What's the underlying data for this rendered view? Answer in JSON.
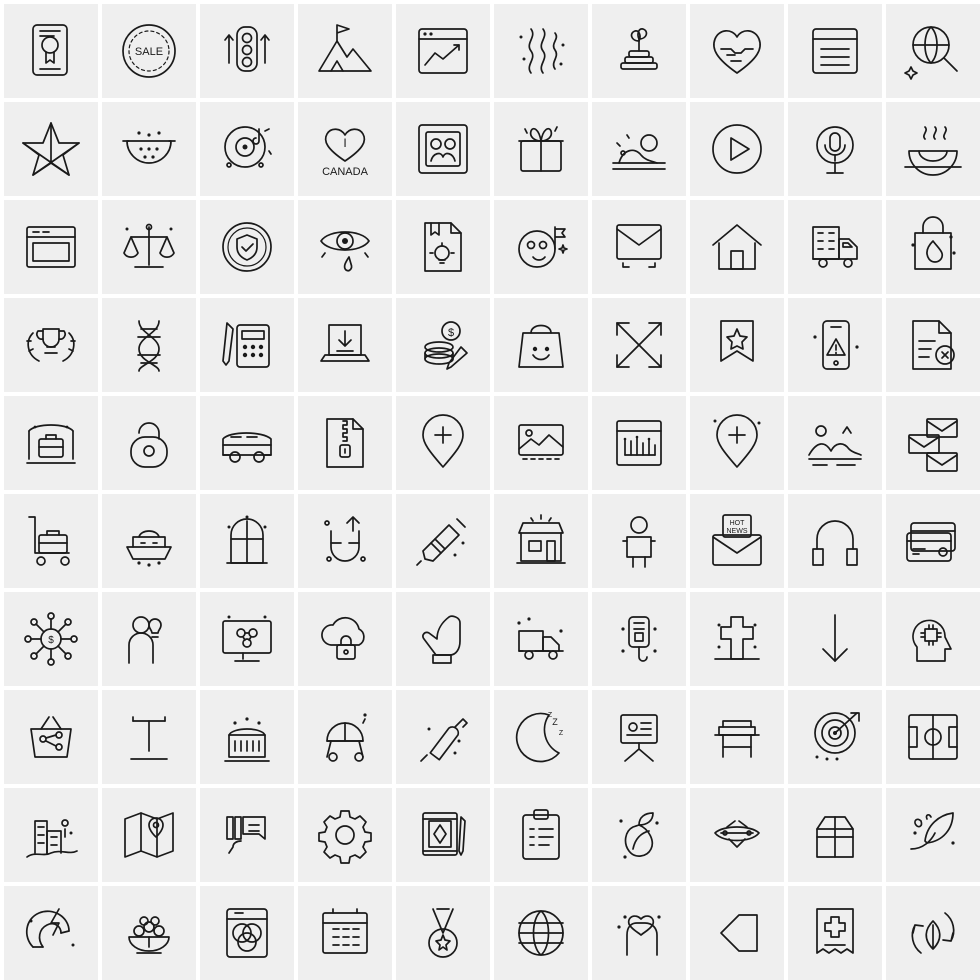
{
  "page": {
    "title": "Line Icon Set Sheet",
    "grid": {
      "columns": 10,
      "rows": 10,
      "cell_size": 94,
      "gap": 4
    },
    "colors": {
      "background": "#ffffff",
      "cell_background": "#efefef",
      "stroke": "#1a1a1a"
    }
  },
  "icons": [
    {
      "row": 1,
      "col": 1,
      "name": "certificate-document-icon",
      "label": ""
    },
    {
      "row": 1,
      "col": 2,
      "name": "sale-badge-icon",
      "label": "SALE"
    },
    {
      "row": 1,
      "col": 3,
      "name": "traffic-light-icon",
      "label": ""
    },
    {
      "row": 1,
      "col": 4,
      "name": "mountain-flag-icon",
      "label": ""
    },
    {
      "row": 1,
      "col": 5,
      "name": "browser-chart-icon",
      "label": ""
    },
    {
      "row": 1,
      "col": 6,
      "name": "heat-waves-icon",
      "label": ""
    },
    {
      "row": 1,
      "col": 7,
      "name": "plant-coins-growth-icon",
      "label": ""
    },
    {
      "row": 1,
      "col": 8,
      "name": "heart-handshake-icon",
      "label": ""
    },
    {
      "row": 1,
      "col": 9,
      "name": "document-lines-icon",
      "label": ""
    },
    {
      "row": 1,
      "col": 10,
      "name": "global-search-icon",
      "label": ""
    },
    {
      "row": 2,
      "col": 1,
      "name": "star-ribbon-icon",
      "label": ""
    },
    {
      "row": 2,
      "col": 2,
      "name": "colander-strainer-icon",
      "label": ""
    },
    {
      "row": 2,
      "col": 3,
      "name": "vinyl-record-music-icon",
      "label": ""
    },
    {
      "row": 2,
      "col": 4,
      "name": "i-love-canada-icon",
      "label": "CANADA"
    },
    {
      "row": 2,
      "col": 5,
      "name": "framed-portrait-icon",
      "label": ""
    },
    {
      "row": 2,
      "col": 6,
      "name": "gift-box-icon",
      "label": ""
    },
    {
      "row": 2,
      "col": 7,
      "name": "sunset-hills-icon",
      "label": ""
    },
    {
      "row": 2,
      "col": 8,
      "name": "play-button-icon",
      "label": ""
    },
    {
      "row": 2,
      "col": 9,
      "name": "microphone-icon",
      "label": ""
    },
    {
      "row": 2,
      "col": 10,
      "name": "soup-bowl-icon",
      "label": ""
    },
    {
      "row": 3,
      "col": 1,
      "name": "window-frame-icon",
      "label": ""
    },
    {
      "row": 3,
      "col": 2,
      "name": "justice-scales-icon",
      "label": ""
    },
    {
      "row": 3,
      "col": 3,
      "name": "shield-protection-icon",
      "label": ""
    },
    {
      "row": 3,
      "col": 4,
      "name": "eye-tear-icon",
      "label": ""
    },
    {
      "row": 3,
      "col": 5,
      "name": "idea-document-icon",
      "label": ""
    },
    {
      "row": 3,
      "col": 6,
      "name": "moon-flag-icon",
      "label": ""
    },
    {
      "row": 3,
      "col": 7,
      "name": "email-envelope-icon",
      "label": ""
    },
    {
      "row": 3,
      "col": 8,
      "name": "home-house-icon",
      "label": ""
    },
    {
      "row": 3,
      "col": 9,
      "name": "delivery-truck-building-icon",
      "label": ""
    },
    {
      "row": 3,
      "col": 10,
      "name": "fire-bag-icon",
      "label": ""
    },
    {
      "row": 4,
      "col": 1,
      "name": "trophy-laurel-icon",
      "label": ""
    },
    {
      "row": 4,
      "col": 2,
      "name": "dna-helix-icon",
      "label": ""
    },
    {
      "row": 4,
      "col": 3,
      "name": "calculator-pen-icon",
      "label": ""
    },
    {
      "row": 4,
      "col": 4,
      "name": "download-laptop-icon",
      "label": ""
    },
    {
      "row": 4,
      "col": 5,
      "name": "money-coins-pen-icon",
      "label": ""
    },
    {
      "row": 4,
      "col": 6,
      "name": "shopping-bag-smile-icon",
      "label": ""
    },
    {
      "row": 4,
      "col": 7,
      "name": "crossed-frame-icon",
      "label": ""
    },
    {
      "row": 4,
      "col": 8,
      "name": "star-badge-ribbon-icon",
      "label": ""
    },
    {
      "row": 4,
      "col": 9,
      "name": "mobile-warning-icon",
      "label": ""
    },
    {
      "row": 4,
      "col": 10,
      "name": "document-error-icon",
      "label": ""
    },
    {
      "row": 5,
      "col": 1,
      "name": "briefcase-stage-icon",
      "label": ""
    },
    {
      "row": 5,
      "col": 2,
      "name": "padlock-round-icon",
      "label": ""
    },
    {
      "row": 5,
      "col": 3,
      "name": "van-vehicle-icon",
      "label": ""
    },
    {
      "row": 5,
      "col": 4,
      "name": "zip-file-icon",
      "label": ""
    },
    {
      "row": 5,
      "col": 5,
      "name": "add-location-pin-icon",
      "label": ""
    },
    {
      "row": 5,
      "col": 6,
      "name": "photo-gallery-icon",
      "label": ""
    },
    {
      "row": 5,
      "col": 7,
      "name": "analytics-board-icon",
      "label": ""
    },
    {
      "row": 5,
      "col": 8,
      "name": "medical-location-pin-icon",
      "label": ""
    },
    {
      "row": 5,
      "col": 9,
      "name": "island-scenery-icon",
      "label": ""
    },
    {
      "row": 5,
      "col": 10,
      "name": "multiple-envelopes-icon",
      "label": ""
    },
    {
      "row": 6,
      "col": 1,
      "name": "luggage-cart-icon",
      "label": ""
    },
    {
      "row": 6,
      "col": 2,
      "name": "boat-ship-icon",
      "label": ""
    },
    {
      "row": 6,
      "col": 3,
      "name": "arch-window-icon",
      "label": ""
    },
    {
      "row": 6,
      "col": 4,
      "name": "magnet-arrow-icon",
      "label": ""
    },
    {
      "row": 6,
      "col": 5,
      "name": "syringe-injection-icon",
      "label": ""
    },
    {
      "row": 6,
      "col": 6,
      "name": "storefront-shop-icon",
      "label": ""
    },
    {
      "row": 6,
      "col": 7,
      "name": "person-standing-icon",
      "label": ""
    },
    {
      "row": 6,
      "col": 8,
      "name": "hot-news-envelope-icon",
      "label": "HOT NEWS"
    },
    {
      "row": 6,
      "col": 9,
      "name": "headphones-icon",
      "label": ""
    },
    {
      "row": 6,
      "col": 10,
      "name": "credit-cards-icon",
      "label": ""
    },
    {
      "row": 7,
      "col": 1,
      "name": "money-network-icon",
      "label": ""
    },
    {
      "row": 7,
      "col": 2,
      "name": "person-idea-icon",
      "label": ""
    },
    {
      "row": 7,
      "col": 3,
      "name": "monitor-molecule-icon",
      "label": ""
    },
    {
      "row": 7,
      "col": 4,
      "name": "cloud-security-lock-icon",
      "label": ""
    },
    {
      "row": 7,
      "col": 5,
      "name": "hand-care-icon",
      "label": ""
    },
    {
      "row": 7,
      "col": 6,
      "name": "delivery-truck-icon",
      "label": ""
    },
    {
      "row": 7,
      "col": 7,
      "name": "iv-drip-bag-icon",
      "label": ""
    },
    {
      "row": 7,
      "col": 8,
      "name": "grave-cross-icon",
      "label": ""
    },
    {
      "row": 7,
      "col": 9,
      "name": "down-arrow-icon",
      "label": ""
    },
    {
      "row": 7,
      "col": 10,
      "name": "head-gear-thinking-icon",
      "label": ""
    },
    {
      "row": 8,
      "col": 1,
      "name": "share-basket-icon",
      "label": ""
    },
    {
      "row": 8,
      "col": 2,
      "name": "text-tool-icon",
      "label": ""
    },
    {
      "row": 8,
      "col": 3,
      "name": "fountain-water-icon",
      "label": ""
    },
    {
      "row": 8,
      "col": 4,
      "name": "baby-stroller-icon",
      "label": ""
    },
    {
      "row": 8,
      "col": 5,
      "name": "rolling-pin-icon",
      "label": ""
    },
    {
      "row": 8,
      "col": 6,
      "name": "sleep-moon-icon",
      "label": "Z"
    },
    {
      "row": 8,
      "col": 7,
      "name": "presentation-easel-icon",
      "label": ""
    },
    {
      "row": 8,
      "col": 8,
      "name": "school-desk-icon",
      "label": ""
    },
    {
      "row": 8,
      "col": 9,
      "name": "target-dartboard-icon",
      "label": ""
    },
    {
      "row": 8,
      "col": 10,
      "name": "football-field-icon",
      "label": ""
    },
    {
      "row": 9,
      "col": 1,
      "name": "city-buildings-icon",
      "label": ""
    },
    {
      "row": 9,
      "col": 2,
      "name": "folded-map-pin-icon",
      "label": ""
    },
    {
      "row": 9,
      "col": 3,
      "name": "user-feedback-icon",
      "label": ""
    },
    {
      "row": 9,
      "col": 4,
      "name": "settings-gear-icon",
      "label": ""
    },
    {
      "row": 9,
      "col": 5,
      "name": "book-notebook-pen-icon",
      "label": ""
    },
    {
      "row": 9,
      "col": 6,
      "name": "clipboard-checklist-icon",
      "label": ""
    },
    {
      "row": 9,
      "col": 7,
      "name": "globe-leaf-eco-icon",
      "label": ""
    },
    {
      "row": 9,
      "col": 8,
      "name": "pocket-knife-icon",
      "label": ""
    },
    {
      "row": 9,
      "col": 9,
      "name": "open-cardboard-box-icon",
      "label": ""
    },
    {
      "row": 9,
      "col": 10,
      "name": "love-letter-quill-icon",
      "label": ""
    },
    {
      "row": 10,
      "col": 1,
      "name": "magnet-power-icon",
      "label": ""
    },
    {
      "row": 10,
      "col": 2,
      "name": "fruit-bowl-scale-icon",
      "label": ""
    },
    {
      "row": 10,
      "col": 3,
      "name": "color-venn-document-icon",
      "label": ""
    },
    {
      "row": 10,
      "col": 4,
      "name": "calendar-grid-icon",
      "label": ""
    },
    {
      "row": 10,
      "col": 5,
      "name": "award-medal-icon",
      "label": ""
    },
    {
      "row": 10,
      "col": 6,
      "name": "globe-grid-icon",
      "label": ""
    },
    {
      "row": 10,
      "col": 7,
      "name": "hand-heart-care-icon",
      "label": ""
    },
    {
      "row": 10,
      "col": 8,
      "name": "chevron-left-banner-icon",
      "label": ""
    },
    {
      "row": 10,
      "col": 9,
      "name": "medical-bill-icon",
      "label": ""
    },
    {
      "row": 10,
      "col": 10,
      "name": "eco-leaf-cycle-icon",
      "label": ""
    }
  ]
}
